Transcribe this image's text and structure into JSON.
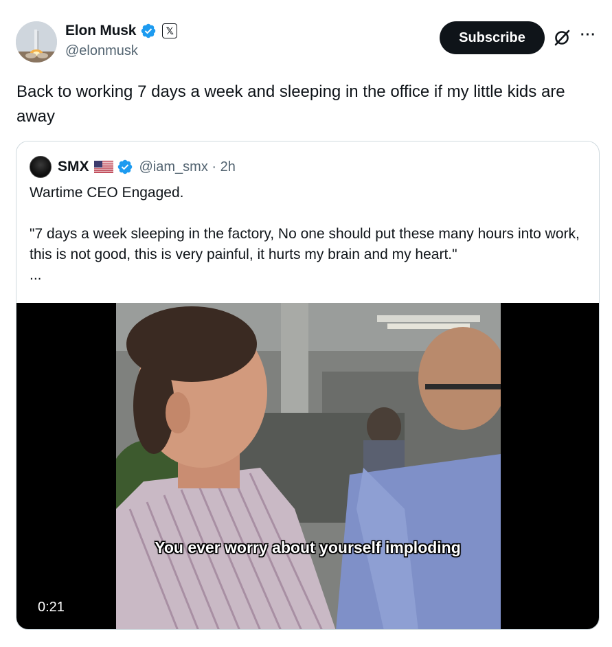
{
  "author": {
    "name": "Elon Musk",
    "handle": "@elonmusk",
    "verified_icon": "verified-badge-icon",
    "affiliation_icon": "x-logo-icon",
    "affiliation_glyph": "𝕏"
  },
  "actions": {
    "subscribe_label": "Subscribe",
    "grok_icon": "grok-icon",
    "more_label": "···"
  },
  "tweet": {
    "text": "Back to working 7 days a week and sleeping in the office if my little kids are away"
  },
  "quoted": {
    "name": "SMX",
    "flag_icon": "us-flag-icon",
    "handle_time": "@iam_smx · 2h",
    "text": "Wartime CEO Engaged.\n\n\"7 days a week sleeping in the factory, No one should put these many hours into work, this is not good, this is very painful, it hurts my brain and my heart.\"\n...",
    "video": {
      "caption": "You ever worry about yourself imploding",
      "duration": "0:21"
    }
  },
  "colors": {
    "verified_blue": "#1d9bf0",
    "text_primary": "#0f1419",
    "text_secondary": "#536471",
    "border": "#cfd9de"
  }
}
